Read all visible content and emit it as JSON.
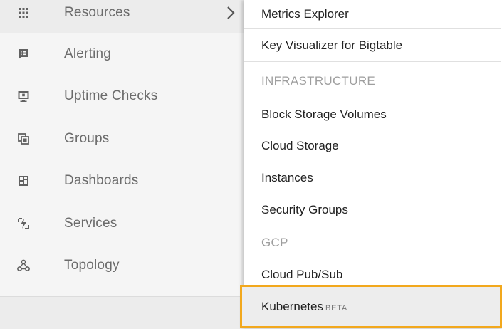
{
  "sidebar": {
    "items": [
      {
        "label": "Resources",
        "icon": "apps-grid-icon",
        "active": true
      },
      {
        "label": "Alerting",
        "icon": "alert-message-icon"
      },
      {
        "label": "Uptime Checks",
        "icon": "monitor-icon"
      },
      {
        "label": "Groups",
        "icon": "groups-icon"
      },
      {
        "label": "Dashboards",
        "icon": "dashboard-icon"
      },
      {
        "label": "Services",
        "icon": "services-icon"
      },
      {
        "label": "Topology",
        "icon": "topology-icon"
      }
    ]
  },
  "menu": {
    "metrics_explorer": "Metrics Explorer",
    "key_visualizer": "Key Visualizer for Bigtable",
    "infrastructure_heading": "INFRASTRUCTURE",
    "block_storage": "Block Storage Volumes",
    "cloud_storage": "Cloud Storage",
    "instances": "Instances",
    "security_groups": "Security Groups",
    "gcp_heading": "GCP",
    "cloud_pubsub": "Cloud Pub/Sub",
    "kubernetes": "Kubernetes",
    "kubernetes_badge": "BETA"
  },
  "colors": {
    "highlight_border": "#f2a81d",
    "active_background": "#ececec"
  }
}
